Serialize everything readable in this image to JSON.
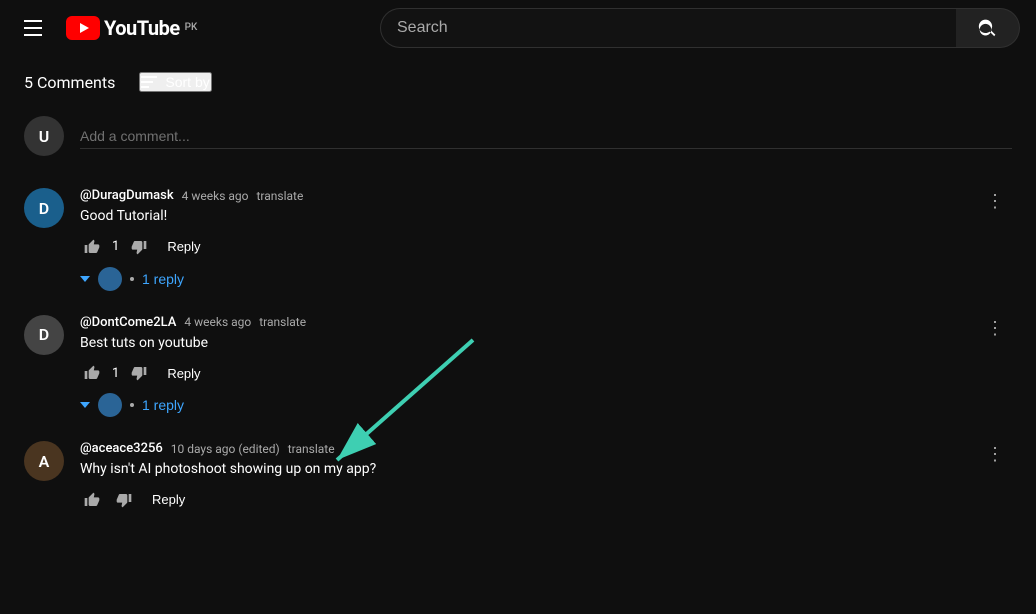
{
  "header": {
    "menu_label": "Menu",
    "logo_text": "YouTube",
    "logo_country": "PK",
    "search_placeholder": "Search"
  },
  "comments_section": {
    "count_label": "5 Comments",
    "sort_label": "Sort by",
    "add_comment_placeholder": "Add a comment...",
    "comments": [
      {
        "id": 1,
        "author": "@DuragDumask",
        "time": "4 weeks ago",
        "translate": "translate",
        "text": "Good Tutorial!",
        "likes": "1",
        "reply_label": "Reply",
        "replies_count": "1 reply",
        "has_replies": true
      },
      {
        "id": 2,
        "author": "@DontCome2LA",
        "time": "4 weeks ago",
        "translate": "translate",
        "text": "Best tuts on youtube",
        "likes": "1",
        "reply_label": "Reply",
        "replies_count": "1 reply",
        "has_replies": true
      },
      {
        "id": 3,
        "author": "@aceace3256",
        "time": "10 days ago (edited)",
        "translate": "translate",
        "text": "Why isn't AI photoshoot showing up on my app?",
        "likes": "",
        "reply_label": "Reply",
        "has_replies": false
      }
    ]
  }
}
